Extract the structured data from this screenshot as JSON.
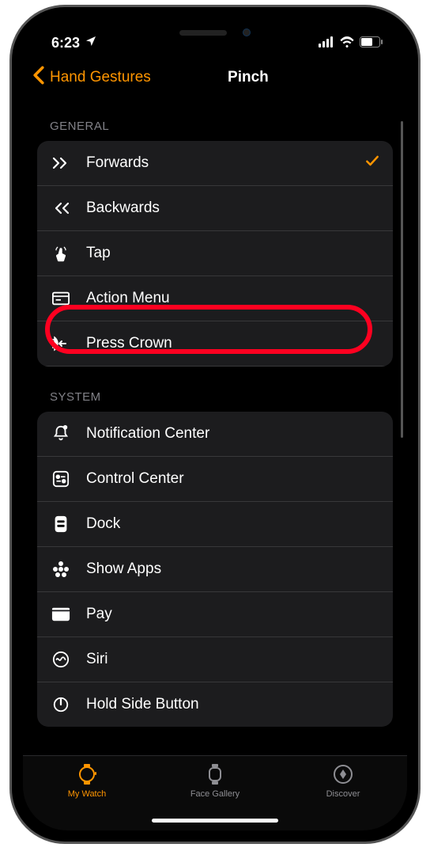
{
  "status": {
    "time": "6:23",
    "location_icon": "location-arrow"
  },
  "nav": {
    "back_label": "Hand Gestures",
    "title": "Pinch"
  },
  "sections": [
    {
      "header": "GENERAL",
      "rows": [
        {
          "icon": "forwards-icon",
          "label": "Forwards",
          "selected": true
        },
        {
          "icon": "backwards-icon",
          "label": "Backwards"
        },
        {
          "icon": "tap-icon",
          "label": "Tap"
        },
        {
          "icon": "action-menu-icon",
          "label": "Action Menu"
        },
        {
          "icon": "press-crown-icon",
          "label": "Press Crown",
          "highlighted": true
        }
      ]
    },
    {
      "header": "SYSTEM",
      "rows": [
        {
          "icon": "notification-center-icon",
          "label": "Notification Center"
        },
        {
          "icon": "control-center-icon",
          "label": "Control Center"
        },
        {
          "icon": "dock-icon",
          "label": "Dock"
        },
        {
          "icon": "show-apps-icon",
          "label": "Show Apps"
        },
        {
          "icon": "apple-pay-icon",
          "label": "Pay",
          "apple_prefix": true
        },
        {
          "icon": "siri-icon",
          "label": "Siri"
        },
        {
          "icon": "hold-side-button-icon",
          "label": "Hold Side Button"
        }
      ]
    }
  ],
  "tabs": [
    {
      "icon": "my-watch-tab-icon",
      "label": "My Watch",
      "active": true
    },
    {
      "icon": "face-gallery-tab-icon",
      "label": "Face Gallery"
    },
    {
      "icon": "discover-tab-icon",
      "label": "Discover"
    }
  ]
}
